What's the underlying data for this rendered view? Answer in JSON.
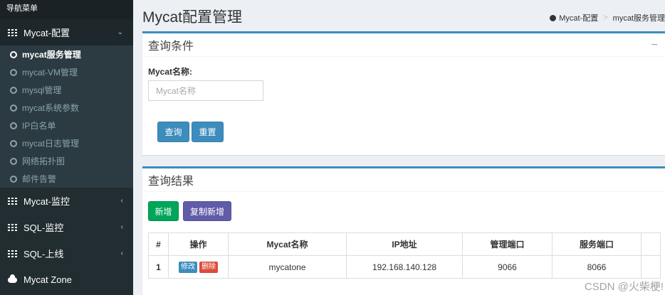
{
  "sidebar": {
    "header": "导航菜单",
    "groups": [
      {
        "label": "Mycat-配置",
        "chev": "⌄",
        "expanded": true
      },
      {
        "label": "Mycat-监控",
        "chev": "‹"
      },
      {
        "label": "SQL-监控",
        "chev": "‹"
      },
      {
        "label": "SQL-上线",
        "chev": "‹"
      },
      {
        "label": "Mycat Zone"
      }
    ],
    "sub_items": [
      {
        "label": "mycat服务管理",
        "active": true
      },
      {
        "label": "mycat-VM管理"
      },
      {
        "label": "mysql管理"
      },
      {
        "label": "mycat系统参数"
      },
      {
        "label": "IP白名单"
      },
      {
        "label": "mycat日志管理"
      },
      {
        "label": "网络拓扑图"
      },
      {
        "label": "邮件告警"
      }
    ]
  },
  "header": {
    "title": "Mycat配置管理",
    "breadcrumb": [
      "Mycat-配置",
      ">",
      "mycat服务管理"
    ]
  },
  "query_box": {
    "title": "查询条件",
    "collapse": "−",
    "field_label": "Mycat名称:",
    "field_placeholder": "Mycat名称",
    "field_value": "",
    "query_btn": "查询",
    "reset_btn": "重置"
  },
  "result_box": {
    "title": "查询结果",
    "add_btn": "新增",
    "copy_btn": "复制新增",
    "columns": [
      "#",
      "操作",
      "Mycat名称",
      "IP地址",
      "管理端口",
      "服务端口"
    ],
    "rows": [
      {
        "num": "1",
        "edit": "修改",
        "del": "删除",
        "name": "mycatone",
        "ip": "192.168.140.128",
        "mport": "9066",
        "sport": "8066"
      }
    ]
  },
  "watermark": "CSDN @火柴梗!",
  "colors": {
    "primary": "#3c8dbc",
    "success": "#00a65a",
    "purple": "#605ca8",
    "danger": "#dd4b39",
    "sidebar": "#222d32"
  }
}
